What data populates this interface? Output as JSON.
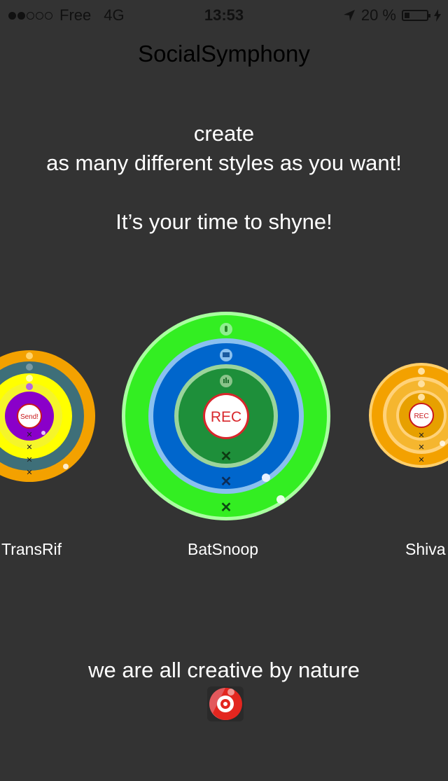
{
  "status_bar": {
    "carrier": "Free",
    "network": "4G",
    "time": "13:53",
    "battery": "20 %",
    "signal_bars": 2
  },
  "header": {
    "title": "SocialSymphony"
  },
  "intro": {
    "line1": "create",
    "line2": "as many different styles as you want!",
    "line3": "It’s your time to shyne!"
  },
  "styles": [
    {
      "name": "TransRif",
      "center_label": "Send!",
      "ring_colors": [
        "#f3a100",
        "#3e6f79",
        "#ffff00",
        "#8a00c9"
      ]
    },
    {
      "name": "BatSnoop",
      "center_label": "REC",
      "ring_colors": [
        "#33ff33",
        "#0066cc",
        "#1e8f3a"
      ]
    },
    {
      "name": "Shiva",
      "center_label": "REC",
      "ring_colors": [
        "#f3a100",
        "#f5b62f",
        "#e7a000"
      ]
    }
  ],
  "footer": {
    "text": "we are all creative by nature"
  },
  "colors": {
    "background": "#333333",
    "rec_red": "#d8262b"
  }
}
